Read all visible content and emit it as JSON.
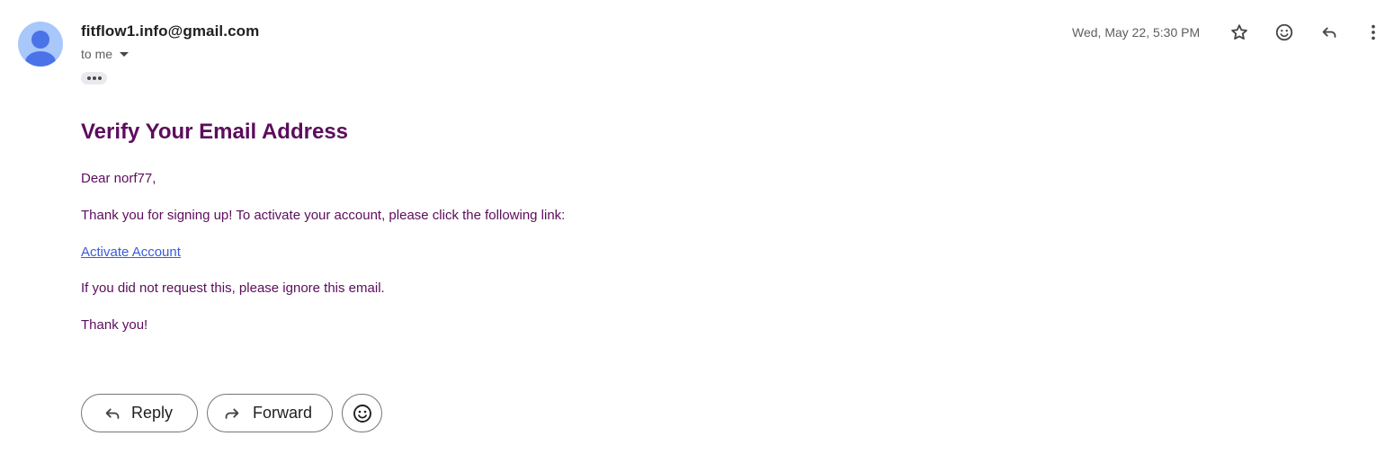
{
  "email": {
    "sender": "fitflow1.info@gmail.com",
    "recipient_label": "to me",
    "date": "Wed, May 22, 5:30 PM"
  },
  "toolbar": {
    "icons": [
      "star-icon",
      "emoji-icon",
      "reply-icon",
      "more-vert-icon"
    ]
  },
  "message": {
    "headline": "Verify Your Email Address",
    "greeting": "Dear norf77,",
    "intro": "Thank you for signing up! To activate your account, please click the following link:",
    "link_text": "Activate Account",
    "ignore_note": "If you did not request this, please ignore this email.",
    "closing": "Thank you!"
  },
  "actions": {
    "reply_label": "Reply",
    "forward_label": "Forward"
  },
  "colors": {
    "body_text": "#5c0d5c",
    "link": "#3b5bdb",
    "avatar_bg": "#a8c7fa",
    "avatar_fg": "#4a73e8"
  }
}
